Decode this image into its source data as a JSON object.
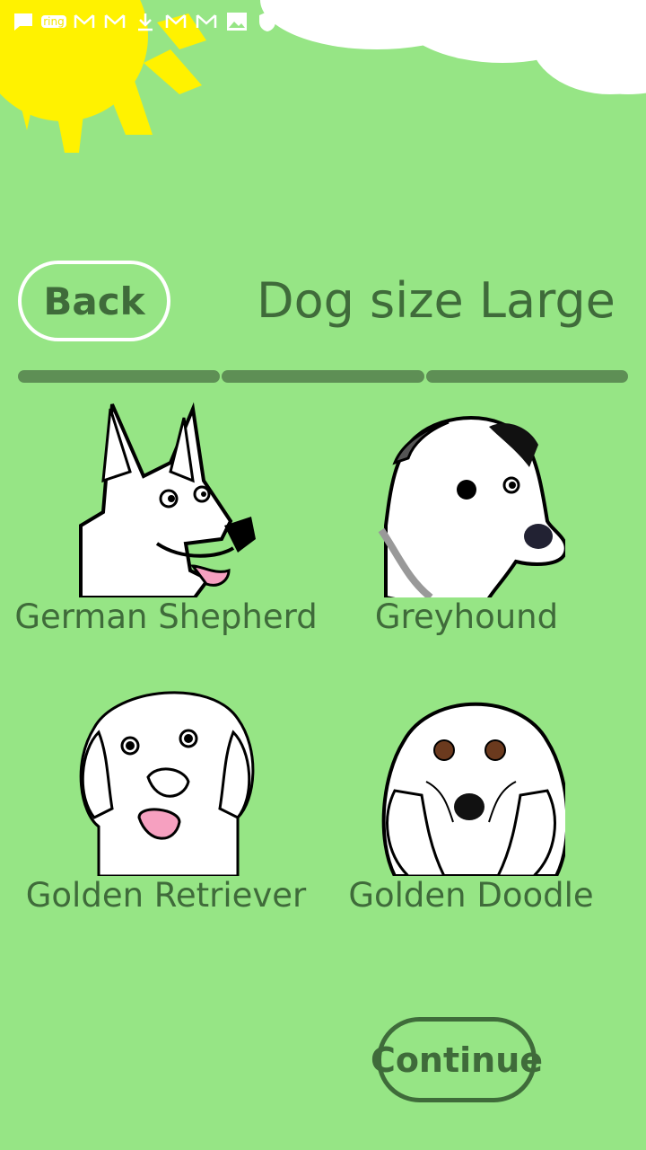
{
  "status_bar": {
    "icons": [
      "message-icon",
      "ring-icon",
      "gmail-icon",
      "gmail-icon",
      "download-icon",
      "gmail-icon",
      "gmail-icon",
      "image-icon",
      "shield-icon"
    ],
    "ring_text": "ring"
  },
  "header": {
    "back_label": "Back",
    "title": "Dog size Large"
  },
  "progress": {
    "segments": 3,
    "completed": 3
  },
  "breeds": [
    {
      "name": "German Shepherd",
      "icon": "german-shepherd-icon"
    },
    {
      "name": "Greyhound",
      "icon": "greyhound-icon"
    },
    {
      "name": "Golden Retriever",
      "icon": "golden-retriever-icon"
    },
    {
      "name": "Golden Doodle",
      "icon": "golden-doodle-icon"
    }
  ],
  "footer": {
    "continue_label": "Continue"
  },
  "colors": {
    "background": "#96e585",
    "text": "#3f6b3a",
    "sun": "#fff200",
    "cloud": "#ffffff"
  }
}
